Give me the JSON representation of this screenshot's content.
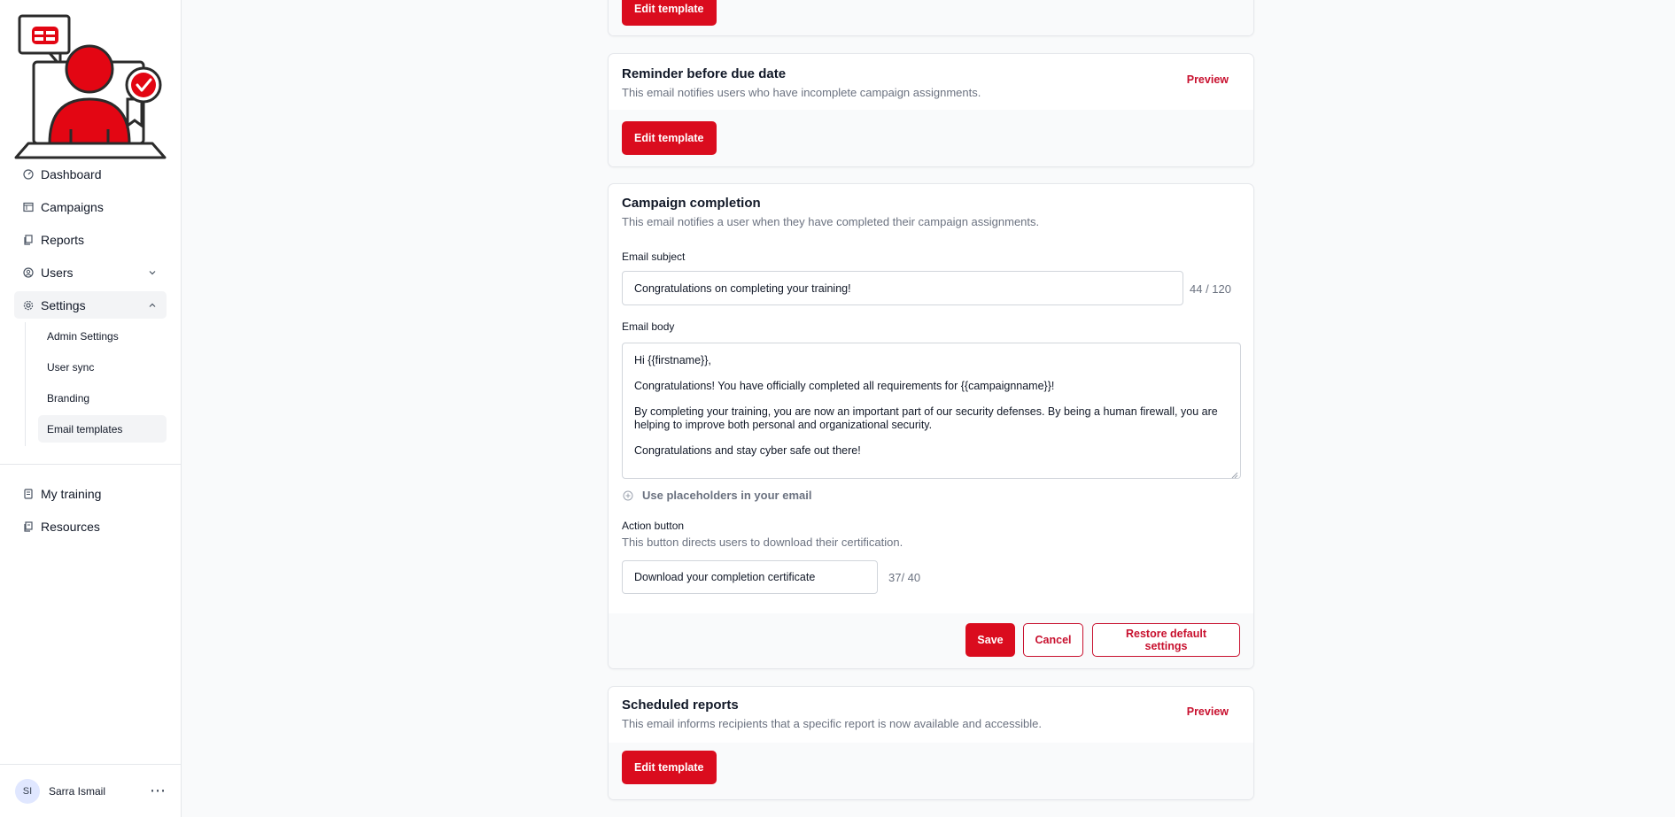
{
  "sidebar": {
    "nav": [
      {
        "label": "Dashboard",
        "icon": "gauge-icon"
      },
      {
        "label": "Campaigns",
        "icon": "calendar-icon"
      },
      {
        "label": "Reports",
        "icon": "copy-icon"
      },
      {
        "label": "Users",
        "icon": "user-circle-icon"
      },
      {
        "label": "Settings",
        "icon": "gear-icon"
      }
    ],
    "settings_sub": [
      {
        "label": "Admin Settings"
      },
      {
        "label": "User sync"
      },
      {
        "label": "Branding"
      },
      {
        "label": "Email templates"
      }
    ],
    "bottom_nav": [
      {
        "label": "My training",
        "icon": "book-icon"
      },
      {
        "label": "Resources",
        "icon": "files-icon"
      }
    ],
    "user": {
      "initials": "SI",
      "name": "Sarra Ismail"
    }
  },
  "cards": {
    "top": {
      "edit_label": "Edit template"
    },
    "reminder": {
      "title": "Reminder before due date",
      "description": "This email notifies users who have incomplete campaign assignments.",
      "preview_label": "Preview",
      "edit_label": "Edit template"
    },
    "completion": {
      "title": "Campaign completion",
      "description": "This email notifies a user when they have completed their campaign assignments.",
      "subject_label": "Email subject",
      "subject_value": "Congratulations on completing your training!",
      "subject_counter": "44 / 120",
      "body_label": "Email body",
      "body_lines": [
        "Hi {{firstname}},",
        "Congratulations! You have officially completed all requirements for {{campaignname}}!",
        "By completing your training, you are now an important part of our security defenses. By being a human firewall, you are helping to improve both personal and organizational security.",
        "Congratulations and stay cyber safe out there!"
      ],
      "placeholders_label": "Use placeholders in your email",
      "action_label": "Action button",
      "action_description": "This button directs users to download their certification.",
      "action_value": "Download your completion certificate",
      "action_counter": "37/ 40",
      "save_label": "Save",
      "cancel_label": "Cancel",
      "restore_label": "Restore default settings"
    },
    "scheduled": {
      "title": "Scheduled reports",
      "description": "This email informs recipients that a specific report is now available and accessible.",
      "preview_label": "Preview",
      "edit_label": "Edit template"
    }
  },
  "colors": {
    "brand": "#da0c1e",
    "text": "#111827",
    "muted": "#6b7280",
    "border": "#e5e7eb"
  }
}
